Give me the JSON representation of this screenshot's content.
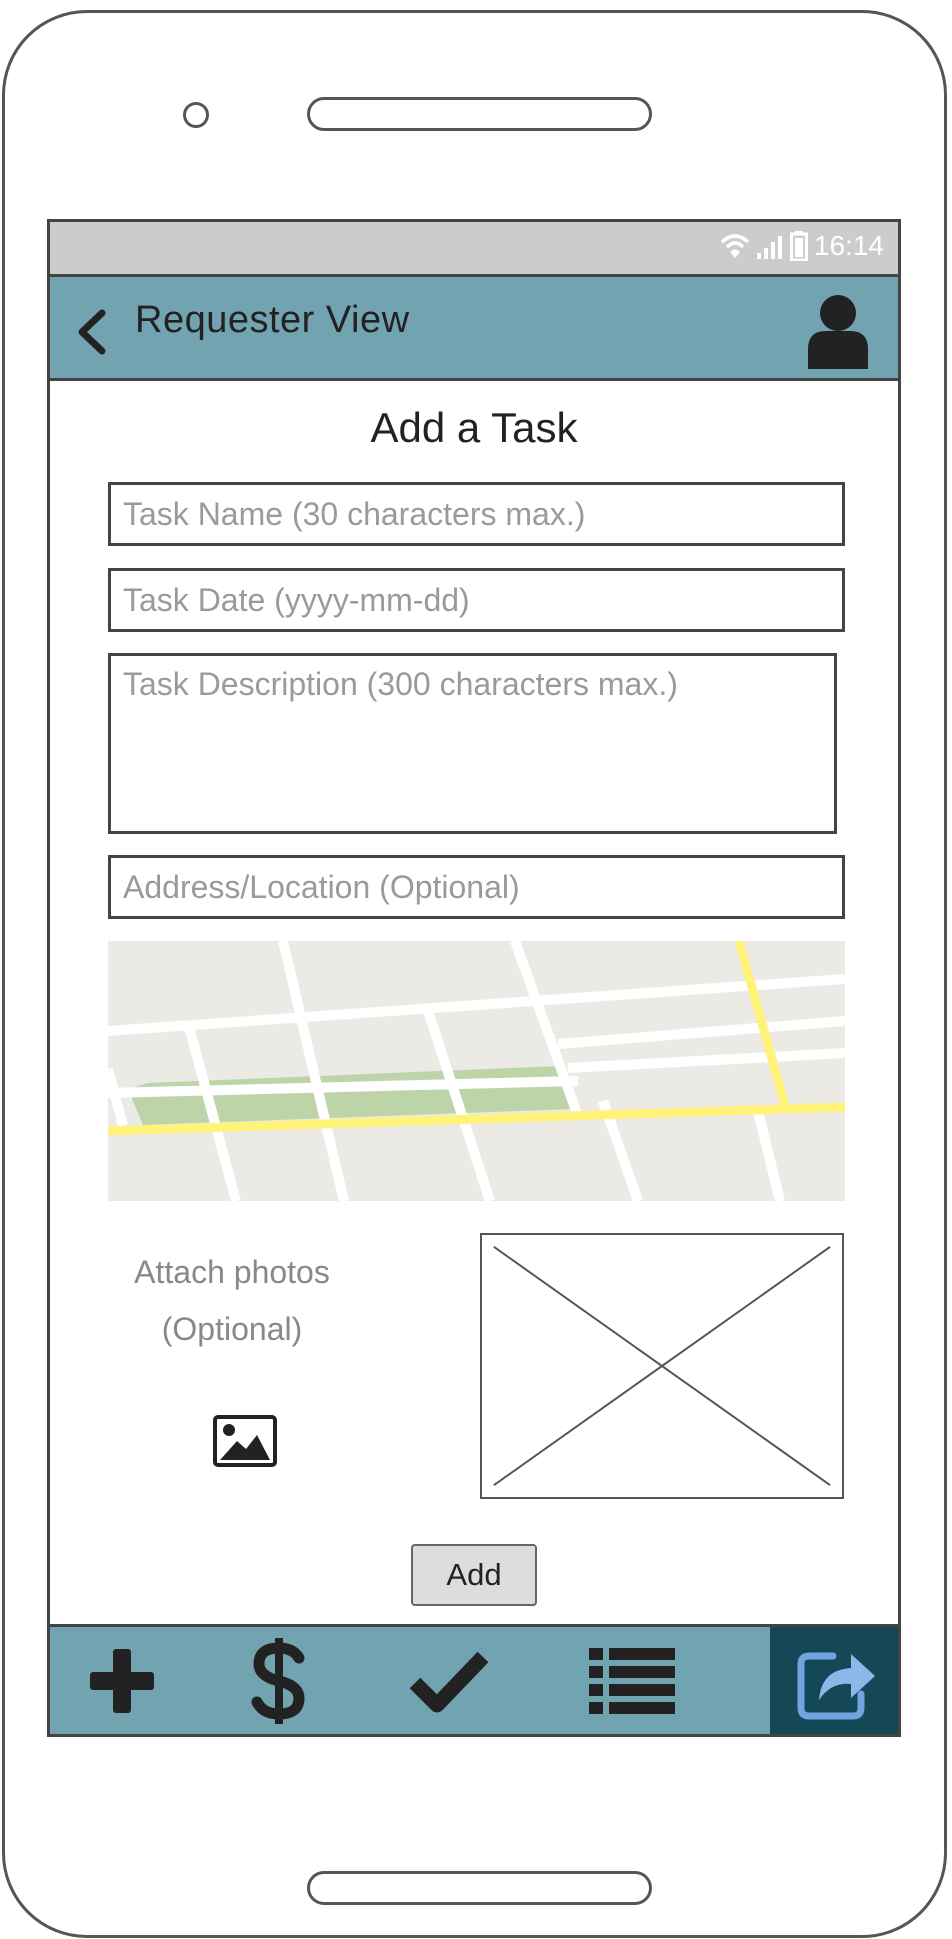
{
  "status_bar": {
    "time": "16:14"
  },
  "app_bar": {
    "title": "Requester View"
  },
  "page": {
    "title": "Add a Task"
  },
  "form": {
    "task_name": {
      "value": "",
      "placeholder": "Task Name (30 characters max.)"
    },
    "task_date": {
      "value": "",
      "placeholder": "Task Date (yyyy-mm-dd)"
    },
    "task_description": {
      "value": "",
      "placeholder": "Task Description (300 characters max.)"
    },
    "address": {
      "value": "",
      "placeholder": "Address/Location (Optional)"
    }
  },
  "attach": {
    "line1": "Attach photos",
    "line2": "(Optional)"
  },
  "add_button": {
    "label": "Add"
  },
  "bottom_nav": [
    {
      "icon": "plus-icon"
    },
    {
      "icon": "dollar-icon"
    },
    {
      "icon": "checkmark-icon"
    },
    {
      "icon": "list-icon"
    },
    {
      "icon": "share-icon",
      "active": true
    }
  ],
  "colors": {
    "app_bar": "#72a3b0",
    "status_bar": "#cccccc",
    "nav_active": "#154857",
    "map_road_major": "#fff37a",
    "map_park": "#bcd4a8",
    "map_background": "#ebeae4"
  }
}
